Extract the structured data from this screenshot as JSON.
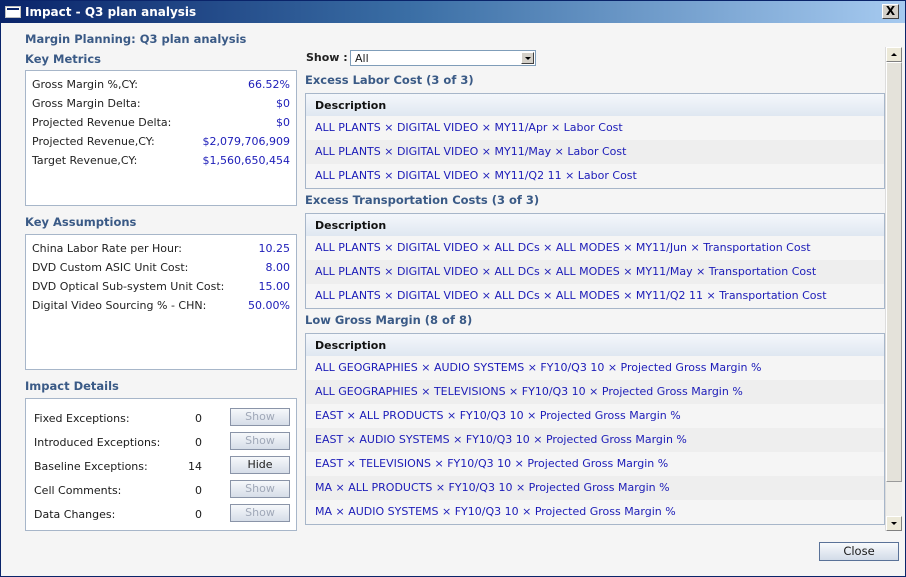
{
  "window": {
    "title": "Impact - Q3 plan analysis",
    "close_glyph": "X"
  },
  "page_title": "Margin Planning: Q3 plan analysis",
  "key_metrics": {
    "heading": "Key Metrics",
    "rows": [
      {
        "label": "Gross Margin %,CY:",
        "value": "66.52%"
      },
      {
        "label": "Gross Margin Delta:",
        "value": "$0"
      },
      {
        "label": "Projected Revenue Delta:",
        "value": "$0"
      },
      {
        "label": "Projected Revenue,CY:",
        "value": "$2,079,706,909"
      },
      {
        "label": "Target Revenue,CY:",
        "value": "$1,560,650,454"
      }
    ]
  },
  "key_assumptions": {
    "heading": "Key Assumptions",
    "rows": [
      {
        "label": "China Labor Rate per Hour:",
        "value": "10.25"
      },
      {
        "label": "DVD Custom ASIC Unit Cost:",
        "value": "8.00"
      },
      {
        "label": "DVD Optical Sub-system Unit Cost:",
        "value": "15.00"
      },
      {
        "label": "Digital Video Sourcing % - CHN:",
        "value": "50.00%"
      }
    ]
  },
  "impact_details": {
    "heading": "Impact Details",
    "rows": [
      {
        "label": "Fixed Exceptions:",
        "count": "0",
        "button": "Show"
      },
      {
        "label": "Introduced Exceptions:",
        "count": "0",
        "button": "Show"
      },
      {
        "label": "Baseline Exceptions:",
        "count": "14",
        "button": "Hide"
      },
      {
        "label": "Cell Comments:",
        "count": "0",
        "button": "Show"
      },
      {
        "label": "Data Changes:",
        "count": "0",
        "button": "Show"
      }
    ]
  },
  "filter": {
    "label": "Show :",
    "selected": "All"
  },
  "sections": [
    {
      "title": "Excess Labor Cost (3 of 3)",
      "column": "Description",
      "rows": [
        "ALL PLANTS × DIGITAL VIDEO × MY11/Apr × Labor Cost",
        "ALL PLANTS × DIGITAL VIDEO × MY11/May × Labor Cost",
        "ALL PLANTS × DIGITAL VIDEO × MY11/Q2 11 × Labor Cost"
      ]
    },
    {
      "title": "Excess Transportation Costs (3 of 3)",
      "column": "Description",
      "rows": [
        "ALL PLANTS × DIGITAL VIDEO × ALL DCs × ALL MODES × MY11/Jun × Transportation Cost",
        "ALL PLANTS × DIGITAL VIDEO × ALL DCs × ALL MODES × MY11/May × Transportation Cost",
        "ALL PLANTS × DIGITAL VIDEO × ALL DCs × ALL MODES × MY11/Q2 11 × Transportation Cost"
      ]
    },
    {
      "title": "Low Gross Margin (8 of 8)",
      "column": "Description",
      "rows": [
        "ALL GEOGRAPHIES × AUDIO SYSTEMS × FY10/Q3 10 × Projected Gross Margin %",
        "ALL GEOGRAPHIES × TELEVISIONS × FY10/Q3 10 × Projected Gross Margin %",
        "EAST × ALL PRODUCTS × FY10/Q3 10 × Projected Gross Margin %",
        "EAST × AUDIO SYSTEMS × FY10/Q3 10 × Projected Gross Margin %",
        "EAST × TELEVISIONS × FY10/Q3 10 × Projected Gross Margin %",
        "MA × ALL PRODUCTS × FY10/Q3 10 × Projected Gross Margin %",
        "MA × AUDIO SYSTEMS × FY10/Q3 10 × Projected Gross Margin %"
      ]
    }
  ],
  "footer": {
    "close_label": "Close"
  }
}
